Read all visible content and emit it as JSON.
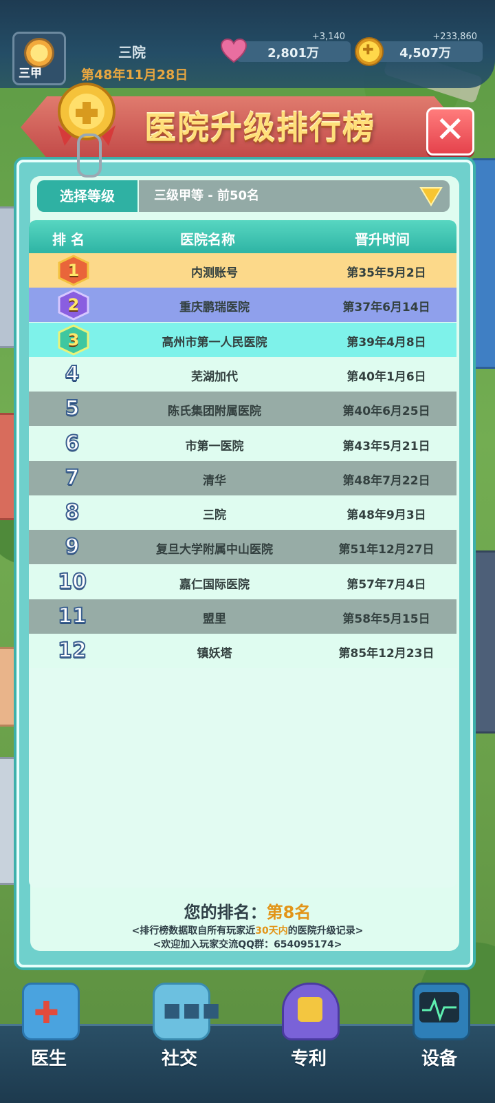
{
  "topbar": {
    "rank_badge": "三甲",
    "hospital_name": "三院",
    "game_date": "第48年11月28日",
    "reputation": {
      "delta": "+3,140",
      "value": "2,801万",
      "icon": "heart-icon"
    },
    "gold": {
      "delta": "+233,860",
      "value": "4,507万",
      "icon": "coin-icon"
    }
  },
  "dialog": {
    "title": "医院升级排行榜",
    "selector_label": "选择等级",
    "selector_value": "三级甲等 - 前50名",
    "columns": {
      "rank": "排 名",
      "name": "医院名称",
      "time": "晋升时间"
    },
    "rows": [
      {
        "rank": "1",
        "name": "内测账号",
        "time": "第35年5月2日"
      },
      {
        "rank": "2",
        "name": "重庆鹏瑞医院",
        "time": "第37年6月14日"
      },
      {
        "rank": "3",
        "name": "高州市第一人民医院",
        "time": "第39年4月8日"
      },
      {
        "rank": "4",
        "name": "芜湖加代",
        "time": "第40年1月6日"
      },
      {
        "rank": "5",
        "name": "陈氏集团附属医院",
        "time": "第40年6月25日"
      },
      {
        "rank": "6",
        "name": "市第一医院",
        "time": "第43年5月21日"
      },
      {
        "rank": "7",
        "name": "清华",
        "time": "第48年7月22日"
      },
      {
        "rank": "8",
        "name": "三院",
        "time": "第48年9月3日"
      },
      {
        "rank": "9",
        "name": "复旦大学附属中山医院",
        "time": "第51年12月27日"
      },
      {
        "rank": "10",
        "name": "嘉仁国际医院",
        "time": "第57年7月4日"
      },
      {
        "rank": "11",
        "name": "盟里",
        "time": "第58年5月15日"
      },
      {
        "rank": "12",
        "name": "镇妖塔",
        "time": "第85年12月23日"
      }
    ],
    "your_rank_label": "您的排名：",
    "your_rank_value": "第8名",
    "note1_pre": "<排行榜数据取自所有玩家近",
    "note1_hl": "30天内",
    "note1_post": "的医院升级记录>",
    "note2": "<欢迎加入玩家交流QQ群：654095174>"
  },
  "nav": [
    {
      "label": "医生",
      "icon": "doctor-icon"
    },
    {
      "label": "社交",
      "icon": "chat-icon"
    },
    {
      "label": "专利",
      "icon": "patent-shield-icon"
    },
    {
      "label": "设备",
      "icon": "monitor-icon"
    }
  ],
  "colors": {
    "row_gold": "#fcd98a",
    "row_silver": "#8fa0ec",
    "row_bronze": "#7ef2ea",
    "row_light": "#dffcf0",
    "row_dark": "#97aca6"
  }
}
